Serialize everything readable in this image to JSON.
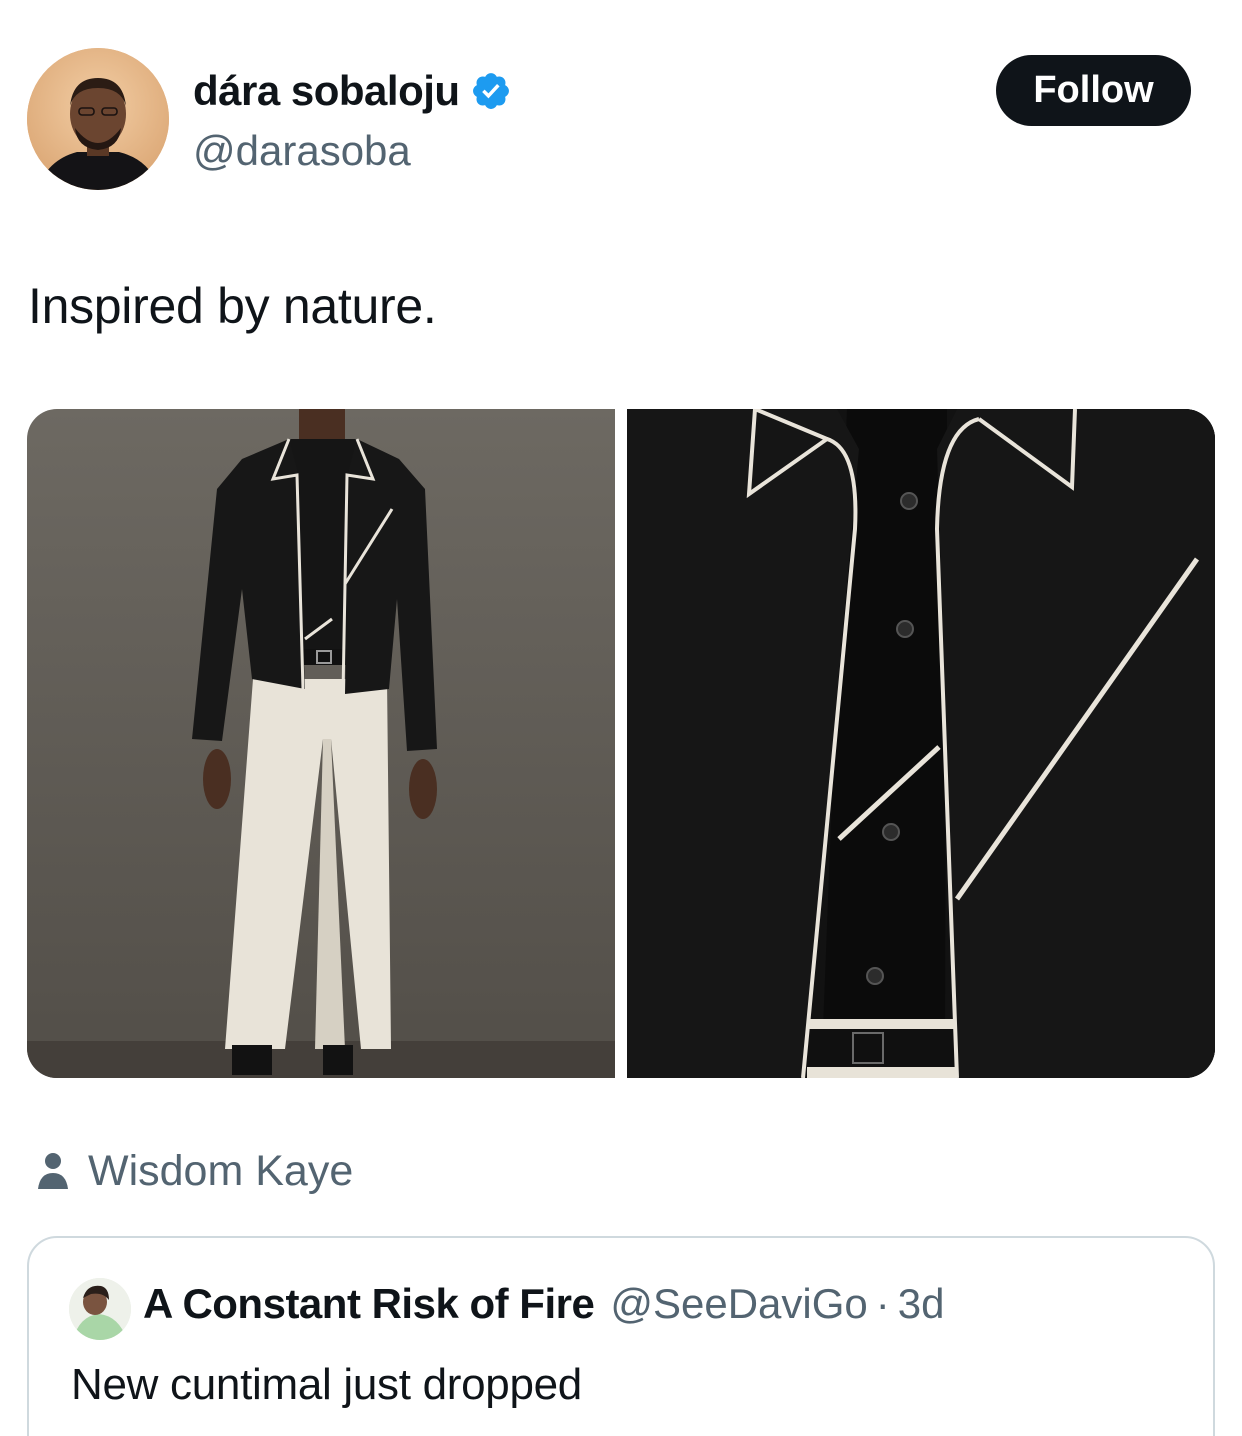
{
  "tweet": {
    "author": {
      "display_name": "dára sobaloju",
      "handle": "@darasoba",
      "verified": true,
      "avatar_icon": "profile-photo"
    },
    "follow_label": "Follow",
    "text": "Inspired by nature.",
    "media_count": 2,
    "media_alt": [
      "full-length outfit photo",
      "close-up jacket detail photo"
    ],
    "tagged_user": "Wisdom Kaye"
  },
  "quote": {
    "display_name": "A Constant Risk of Fire",
    "handle": "@SeeDaviGo",
    "separator": "·",
    "time": "3d",
    "text": "New cuntimal just dropped"
  },
  "colors": {
    "text_primary": "#0f1419",
    "text_secondary": "#536471",
    "verified_blue": "#1d9bf0",
    "follow_button_bg": "#0f1419",
    "border": "#cfd9de"
  }
}
